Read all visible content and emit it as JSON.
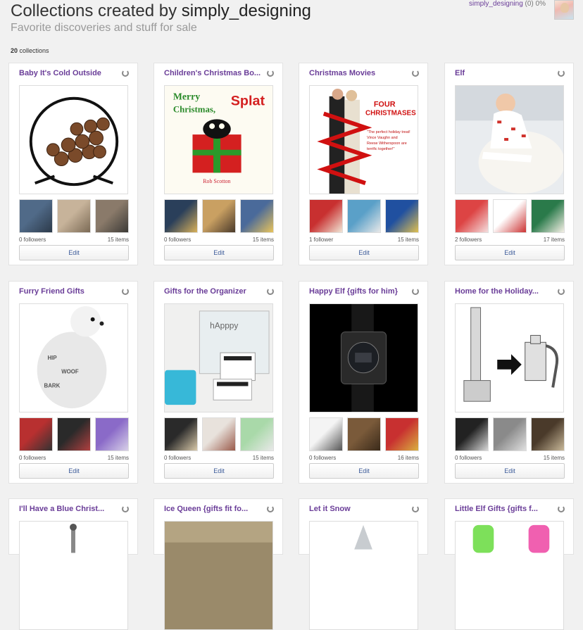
{
  "header": {
    "title_prefix": "Collections created by ",
    "title_user": "simply_designing",
    "subtitle": "Favorite discoveries and stuff for sale",
    "count_number": "20",
    "count_label": " collections",
    "user_link": "simply_designing",
    "user_stats": " (0) 0%"
  },
  "edit_label": "Edit",
  "collections": [
    {
      "title": "Baby It's Cold Outside",
      "followers": "0 followers",
      "items": "15 items"
    },
    {
      "title": "Children's Christmas Bo...",
      "followers": "0 followers",
      "items": "15 items"
    },
    {
      "title": "Christmas Movies",
      "followers": "1 follower",
      "items": "15 items"
    },
    {
      "title": "Elf",
      "followers": "2 followers",
      "items": "17 items"
    },
    {
      "title": "Furry Friend Gifts",
      "followers": "0 followers",
      "items": "15 items"
    },
    {
      "title": "Gifts for the Organizer",
      "followers": "0 followers",
      "items": "15 items"
    },
    {
      "title": "Happy Elf {gifts for him}",
      "followers": "0 followers",
      "items": "16 items"
    },
    {
      "title": "Home for the Holiday...",
      "followers": "0 followers",
      "items": "15 items"
    },
    {
      "title": "I'll Have a Blue Christ...",
      "followers": "",
      "items": ""
    },
    {
      "title": "Ice Queen {gifts fit fo...",
      "followers": "",
      "items": ""
    },
    {
      "title": "Let it Snow",
      "followers": "",
      "items": ""
    },
    {
      "title": "Little Elf Gifts {gifts f...",
      "followers": "",
      "items": ""
    }
  ],
  "main_image_texts": {
    "splat_line1": "Merry",
    "splat_line2": "Christmas,",
    "splat_word": "Splat",
    "splat_author": "Rob Scotton",
    "movie_title": "FOUR CHRISTMASES",
    "movie_quote": "\"The perfect holiday treat! Vince Vaughn and Reese Witherspoon are terrific together!\"",
    "organizer_brand": "hApppy"
  }
}
